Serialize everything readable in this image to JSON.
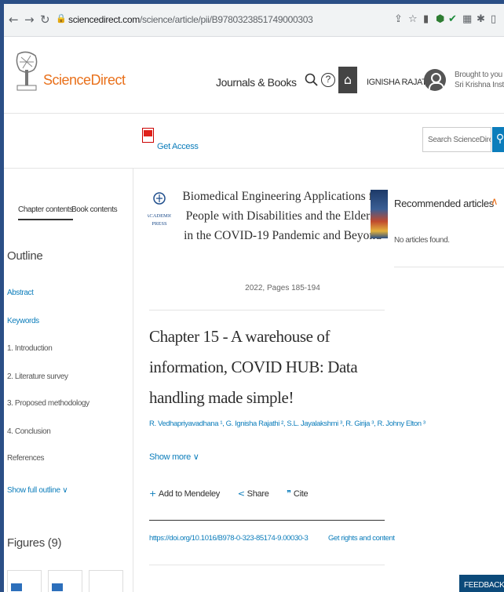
{
  "browser": {
    "url_host": "sciencedirect.com",
    "url_path": "/science/article/pii/B9780323851749000303"
  },
  "header": {
    "brand": "ScienceDirect",
    "journals_books": "Journals & Books",
    "username": "IGNISHA RAJATHI G",
    "brought_line1": "Brought to you by:",
    "brought_line2": "Sri Krishna Institute"
  },
  "subheader": {
    "get_access": "Get Access",
    "search_placeholder": "Search ScienceDirect"
  },
  "sidebar": {
    "tab_chapter": "Chapter contents",
    "tab_book": "Book contents",
    "outline_title": "Outline",
    "outline_items": [
      "Abstract",
      "Keywords",
      "1. Introduction",
      "2. Literature survey",
      "3. Proposed methodology",
      "4. Conclusion",
      "References"
    ],
    "show_full_outline": "Show full outline",
    "figures_title": "Figures (9)"
  },
  "article": {
    "publisher_logo_text": "ACADEMIC PRESS",
    "book_title": "Biomedical Engineering Applications for People with Disabilities and the Elderly in the COVID-19 Pandemic and Beyond",
    "pages": "2022, Pages 185-194",
    "chapter_title": "Chapter 15 - A warehouse of information, COVID HUB: Data handling made simple!",
    "authors": "R. Vedhapriyavadhana ¹, G. Ignisha Rajathi ², S.L. Jayalakshmi ³, R. Girija ³, R. Johny Elton ³",
    "show_more": "Show more",
    "add_mendeley": "Add to Mendeley",
    "share": "Share",
    "cite": "Cite",
    "doi": "https://doi.org/10.1016/B978-0-323-85174-9.00030-3",
    "rights": "Get rights and content"
  },
  "right": {
    "recommended": "Recommended articles",
    "no_articles": "No articles found.",
    "feedback": "FEEDBACK"
  },
  "colors": {
    "brand_orange": "#e9711c",
    "link_blue": "#0c7dbb",
    "frame_blue": "#2b4f86"
  }
}
